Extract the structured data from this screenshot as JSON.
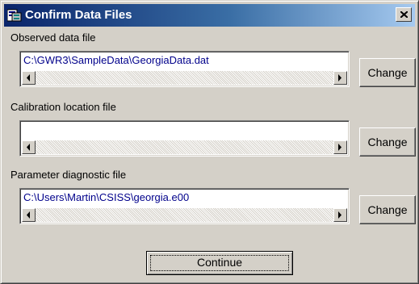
{
  "window": {
    "title": "Confirm Data Files",
    "title_icon": "data-files-icon",
    "close_icon": "close-icon"
  },
  "colors": {
    "titlebar_start": "#0a246a",
    "titlebar_end": "#a6caf0",
    "face": "#d4d0c8",
    "path_text": "#00008b"
  },
  "fields": [
    {
      "label": "Observed data file",
      "value": "C:\\GWR3\\SampleData\\GeorgiaData.dat",
      "button": "Change"
    },
    {
      "label": "Calibration location file",
      "value": "",
      "button": "Change"
    },
    {
      "label": "Parameter diagnostic file",
      "value": "C:\\Users\\Martin\\CSISS\\georgia.e00",
      "button": "Change"
    }
  ],
  "continue_label": "Continue"
}
